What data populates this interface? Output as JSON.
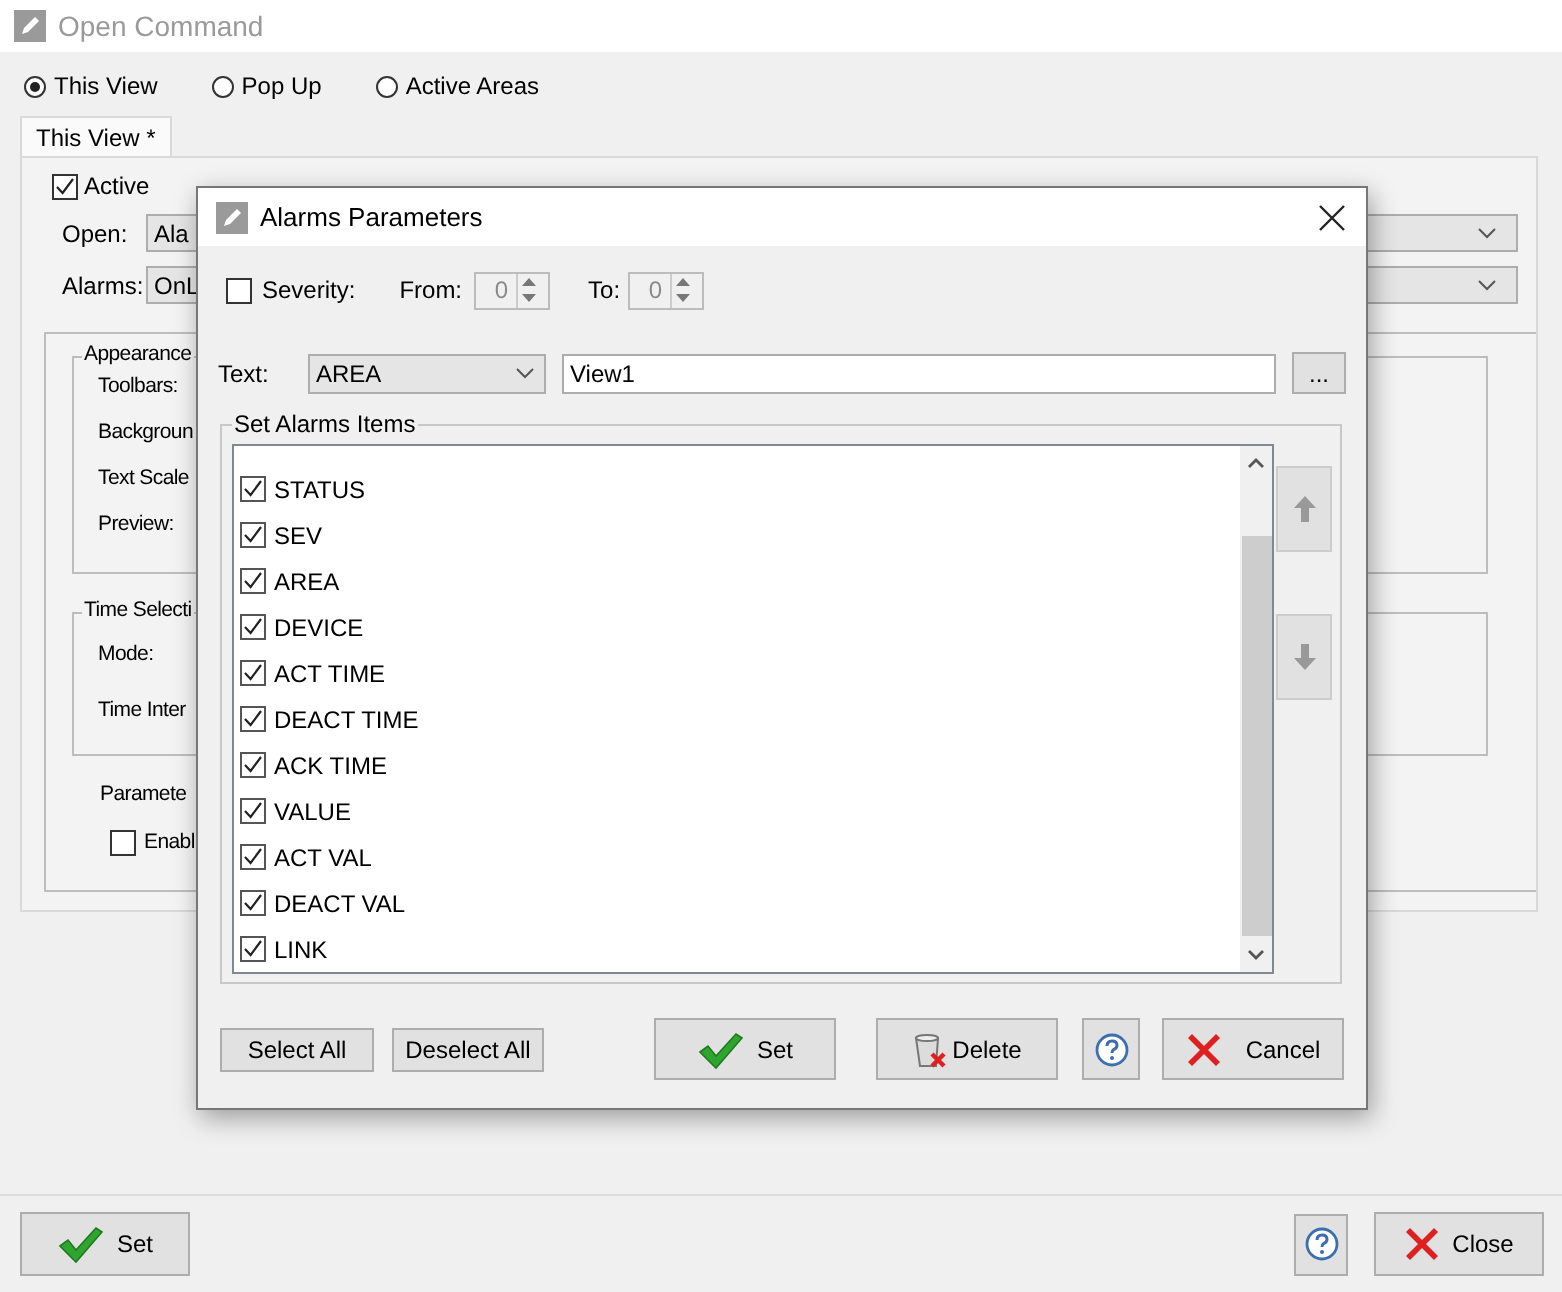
{
  "window": {
    "title": "Open Command"
  },
  "open_mode": [
    {
      "label": "This View",
      "selected": true
    },
    {
      "label": "Pop Up",
      "selected": false
    },
    {
      "label": "Active Areas",
      "selected": false
    }
  ],
  "tabs": [
    {
      "label": "This View *",
      "selected": true
    }
  ],
  "active": {
    "label": "Active",
    "checked": true
  },
  "open": {
    "label": "Open:",
    "value": "Ala"
  },
  "alarms": {
    "label": "Alarms:",
    "value": "OnL"
  },
  "appearance": {
    "title": "Appearance",
    "labels": [
      "Toolbars:",
      "Backgroun",
      "Text Scale",
      "Preview:"
    ]
  },
  "time_selection": {
    "title": "Time Selecti",
    "labels": [
      "Mode:",
      "Time Inter"
    ]
  },
  "parameters": {
    "label": "Paramete",
    "enable": {
      "label": "Enabl",
      "checked": false
    }
  },
  "buttons": {
    "set": "Set",
    "close": "Close"
  },
  "dialog": {
    "title": "Alarms Parameters",
    "severity": {
      "label": "Severity:",
      "checked": false,
      "from_label": "From:",
      "from": "0",
      "to_label": "To:",
      "to": "0"
    },
    "text": {
      "label": "Text:",
      "choice": "AREA",
      "value": "View1",
      "browse": "..."
    },
    "items_group": "Set Alarms Items",
    "items": [
      {
        "label": "STATUS",
        "checked": true
      },
      {
        "label": "SEV",
        "checked": true
      },
      {
        "label": "AREA",
        "checked": true
      },
      {
        "label": "DEVICE",
        "checked": true
      },
      {
        "label": "ACT TIME",
        "checked": true
      },
      {
        "label": "DEACT TIME",
        "checked": true
      },
      {
        "label": "ACK TIME",
        "checked": true
      },
      {
        "label": "VALUE",
        "checked": true
      },
      {
        "label": "ACT VAL",
        "checked": true
      },
      {
        "label": "DEACT VAL",
        "checked": true
      },
      {
        "label": "LINK",
        "checked": true
      }
    ],
    "buttons": {
      "select_all": "Select All",
      "deselect_all": "Deselect All",
      "set": "Set",
      "delete": "Delete",
      "cancel": "Cancel"
    }
  }
}
